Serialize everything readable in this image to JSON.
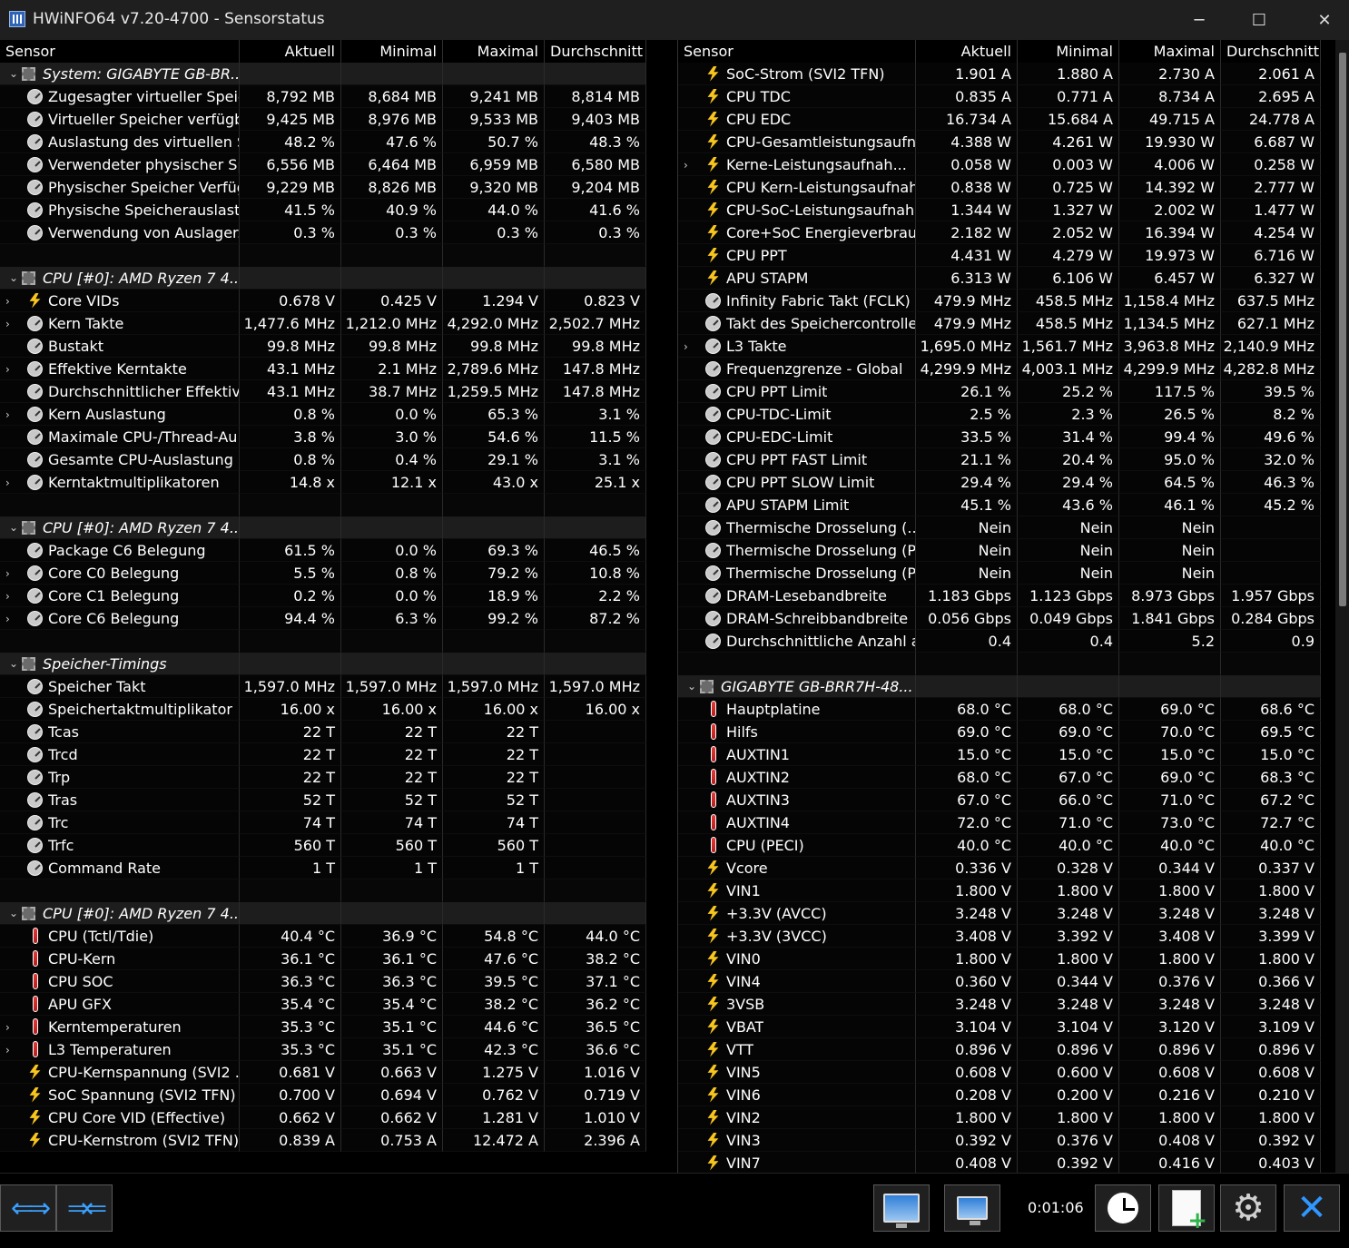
{
  "window": {
    "title": "HWiNFO64 v7.20-4700 - Sensorstatus",
    "minimize": "─",
    "maximize": "☐",
    "close": "✕"
  },
  "columns": [
    "Sensor",
    "Aktuell",
    "Minimal",
    "Maximal",
    "Durchschnitt"
  ],
  "left_rows": [
    {
      "t": "group",
      "name": "System: GIGABYTE GB-BR...",
      "icon": "chip-icon"
    },
    {
      "t": "row",
      "name": "Zugesagter virtueller Speic...",
      "icon": "gauge-icon",
      "v": [
        "8,792 MB",
        "8,684 MB",
        "9,241 MB",
        "8,814 MB"
      ]
    },
    {
      "t": "row",
      "name": "Virtueller Speicher verfügbar",
      "icon": "gauge-icon",
      "v": [
        "9,425 MB",
        "8,976 MB",
        "9,533 MB",
        "9,403 MB"
      ]
    },
    {
      "t": "row",
      "name": "Auslastung des virtuellen S...",
      "icon": "gauge-icon",
      "v": [
        "48.2 %",
        "47.6 %",
        "50.7 %",
        "48.3 %"
      ]
    },
    {
      "t": "row",
      "name": "Verwendeter physischer Sp...",
      "icon": "gauge-icon",
      "v": [
        "6,556 MB",
        "6,464 MB",
        "6,959 MB",
        "6,580 MB"
      ]
    },
    {
      "t": "row",
      "name": "Physischer Speicher Verfüg...",
      "icon": "gauge-icon",
      "v": [
        "9,229 MB",
        "8,826 MB",
        "9,320 MB",
        "9,204 MB"
      ]
    },
    {
      "t": "row",
      "name": "Physische Speicherauslastu...",
      "icon": "gauge-icon",
      "v": [
        "41.5 %",
        "40.9 %",
        "44.0 %",
        "41.6 %"
      ]
    },
    {
      "t": "row",
      "name": "Verwendung von Auslager...",
      "icon": "gauge-icon",
      "v": [
        "0.3 %",
        "0.3 %",
        "0.3 %",
        "0.3 %"
      ]
    },
    {
      "t": "blank"
    },
    {
      "t": "group",
      "name": "CPU [#0]: AMD Ryzen 7 4...",
      "icon": "chip-icon"
    },
    {
      "t": "row",
      "sub": true,
      "name": "Core VIDs",
      "icon": "bolt-icon",
      "v": [
        "0.678 V",
        "0.425 V",
        "1.294 V",
        "0.823 V"
      ]
    },
    {
      "t": "row",
      "sub": true,
      "name": "Kern Takte",
      "icon": "gauge-icon",
      "v": [
        "1,477.6 MHz",
        "1,212.0 MHz",
        "4,292.0 MHz",
        "2,502.7 MHz"
      ]
    },
    {
      "t": "row",
      "name": "Bustakt",
      "icon": "gauge-icon",
      "v": [
        "99.8 MHz",
        "99.8 MHz",
        "99.8 MHz",
        "99.8 MHz"
      ]
    },
    {
      "t": "row",
      "sub": true,
      "name": "Effektive Kerntakte",
      "icon": "gauge-icon",
      "v": [
        "43.1 MHz",
        "2.1 MHz",
        "2,789.6 MHz",
        "147.8 MHz"
      ]
    },
    {
      "t": "row",
      "name": "Durchschnittlicher Effektive...",
      "icon": "gauge-icon",
      "v": [
        "43.1 MHz",
        "38.7 MHz",
        "1,259.5 MHz",
        "147.8 MHz"
      ]
    },
    {
      "t": "row",
      "sub": true,
      "name": "Kern Auslastung",
      "icon": "gauge-icon",
      "v": [
        "0.8 %",
        "0.0 %",
        "65.3 %",
        "3.1 %"
      ]
    },
    {
      "t": "row",
      "name": "Maximale CPU-/Thread-Au...",
      "icon": "gauge-icon",
      "v": [
        "3.8 %",
        "3.0 %",
        "54.6 %",
        "11.5 %"
      ]
    },
    {
      "t": "row",
      "name": "Gesamte CPU-Auslastung",
      "icon": "gauge-icon",
      "v": [
        "0.8 %",
        "0.4 %",
        "29.1 %",
        "3.1 %"
      ]
    },
    {
      "t": "row",
      "sub": true,
      "name": "Kerntaktmultiplikatoren",
      "icon": "gauge-icon",
      "v": [
        "14.8 x",
        "12.1 x",
        "43.0 x",
        "25.1 x"
      ]
    },
    {
      "t": "blank"
    },
    {
      "t": "group",
      "name": "CPU [#0]: AMD Ryzen 7 4...",
      "icon": "chip-icon"
    },
    {
      "t": "row",
      "name": "Package C6 Belegung",
      "icon": "gauge-icon",
      "v": [
        "61.5 %",
        "0.0 %",
        "69.3 %",
        "46.5 %"
      ]
    },
    {
      "t": "row",
      "sub": true,
      "name": "Core C0 Belegung",
      "icon": "gauge-icon",
      "v": [
        "5.5 %",
        "0.8 %",
        "79.2 %",
        "10.8 %"
      ]
    },
    {
      "t": "row",
      "sub": true,
      "name": "Core C1 Belegung",
      "icon": "gauge-icon",
      "v": [
        "0.2 %",
        "0.0 %",
        "18.9 %",
        "2.2 %"
      ]
    },
    {
      "t": "row",
      "sub": true,
      "name": "Core C6 Belegung",
      "icon": "gauge-icon",
      "v": [
        "94.4 %",
        "6.3 %",
        "99.2 %",
        "87.2 %"
      ]
    },
    {
      "t": "blank"
    },
    {
      "t": "group",
      "name": "Speicher-Timings",
      "icon": "chip-icon"
    },
    {
      "t": "row",
      "name": "Speicher Takt",
      "icon": "gauge-icon",
      "v": [
        "1,597.0 MHz",
        "1,597.0 MHz",
        "1,597.0 MHz",
        "1,597.0 MHz"
      ]
    },
    {
      "t": "row",
      "name": "Speichertaktmultiplikator",
      "icon": "gauge-icon",
      "v": [
        "16.00 x",
        "16.00 x",
        "16.00 x",
        "16.00 x"
      ]
    },
    {
      "t": "row",
      "name": "Tcas",
      "icon": "gauge-icon",
      "v": [
        "22 T",
        "22 T",
        "22 T",
        ""
      ]
    },
    {
      "t": "row",
      "name": "Trcd",
      "icon": "gauge-icon",
      "v": [
        "22 T",
        "22 T",
        "22 T",
        ""
      ]
    },
    {
      "t": "row",
      "name": "Trp",
      "icon": "gauge-icon",
      "v": [
        "22 T",
        "22 T",
        "22 T",
        ""
      ]
    },
    {
      "t": "row",
      "name": "Tras",
      "icon": "gauge-icon",
      "v": [
        "52 T",
        "52 T",
        "52 T",
        ""
      ]
    },
    {
      "t": "row",
      "name": "Trc",
      "icon": "gauge-icon",
      "v": [
        "74 T",
        "74 T",
        "74 T",
        ""
      ]
    },
    {
      "t": "row",
      "name": "Trfc",
      "icon": "gauge-icon",
      "v": [
        "560 T",
        "560 T",
        "560 T",
        ""
      ]
    },
    {
      "t": "row",
      "name": "Command Rate",
      "icon": "gauge-icon",
      "v": [
        "1 T",
        "1 T",
        "1 T",
        ""
      ]
    },
    {
      "t": "blank"
    },
    {
      "t": "group",
      "name": "CPU [#0]: AMD Ryzen 7 4...",
      "icon": "chip-icon"
    },
    {
      "t": "row",
      "name": "CPU (Tctl/Tdie)",
      "icon": "thermometer-icon",
      "v": [
        "40.4 °C",
        "36.9 °C",
        "54.8 °C",
        "44.0 °C"
      ]
    },
    {
      "t": "row",
      "name": "CPU-Kern",
      "icon": "thermometer-icon",
      "v": [
        "36.1 °C",
        "36.1 °C",
        "47.6 °C",
        "38.2 °C"
      ]
    },
    {
      "t": "row",
      "name": "CPU SOC",
      "icon": "thermometer-icon",
      "v": [
        "36.3 °C",
        "36.3 °C",
        "39.5 °C",
        "37.1 °C"
      ]
    },
    {
      "t": "row",
      "name": "APU GFX",
      "icon": "thermometer-icon",
      "v": [
        "35.4 °C",
        "35.4 °C",
        "38.2 °C",
        "36.2 °C"
      ]
    },
    {
      "t": "row",
      "sub": true,
      "name": "Kerntemperaturen",
      "icon": "thermometer-icon",
      "v": [
        "35.3 °C",
        "35.1 °C",
        "44.6 °C",
        "36.5 °C"
      ]
    },
    {
      "t": "row",
      "sub": true,
      "name": "L3 Temperaturen",
      "icon": "thermometer-icon",
      "v": [
        "35.3 °C",
        "35.1 °C",
        "42.3 °C",
        "36.6 °C"
      ]
    },
    {
      "t": "row",
      "name": "CPU-Kernspannung (SVI2 ...",
      "icon": "bolt-icon",
      "v": [
        "0.681 V",
        "0.663 V",
        "1.275 V",
        "1.016 V"
      ]
    },
    {
      "t": "row",
      "name": "SoC Spannung (SVI2 TFN)",
      "icon": "bolt-icon",
      "v": [
        "0.700 V",
        "0.694 V",
        "0.762 V",
        "0.719 V"
      ]
    },
    {
      "t": "row",
      "name": "CPU Core VID (Effective)",
      "icon": "bolt-icon",
      "v": [
        "0.662 V",
        "0.662 V",
        "1.281 V",
        "1.010 V"
      ]
    },
    {
      "t": "row",
      "name": "CPU-Kernstrom (SVI2 TFN)",
      "icon": "bolt-icon",
      "v": [
        "0.839 A",
        "0.753 A",
        "12.472 A",
        "2.396 A"
      ]
    }
  ],
  "right_rows": [
    {
      "t": "row",
      "name": "SoC-Strom (SVI2 TFN)",
      "icon": "bolt-icon",
      "v": [
        "1.901 A",
        "1.880 A",
        "2.730 A",
        "2.061 A"
      ]
    },
    {
      "t": "row",
      "name": "CPU TDC",
      "icon": "bolt-icon",
      "v": [
        "0.835 A",
        "0.771 A",
        "8.734 A",
        "2.695 A"
      ]
    },
    {
      "t": "row",
      "name": "CPU EDC",
      "icon": "bolt-icon",
      "v": [
        "16.734 A",
        "15.684 A",
        "49.715 A",
        "24.778 A"
      ]
    },
    {
      "t": "row",
      "name": "CPU-Gesamtleistungsaufn...",
      "icon": "bolt-icon",
      "v": [
        "4.388 W",
        "4.261 W",
        "19.930 W",
        "6.687 W"
      ]
    },
    {
      "t": "row",
      "sub": true,
      "name": "Kerne-Leistungsaufnah...",
      "icon": "bolt-icon",
      "v": [
        "0.058 W",
        "0.003 W",
        "4.006 W",
        "0.258 W"
      ]
    },
    {
      "t": "row",
      "name": "CPU Kern-Leistungsaufnah...",
      "icon": "bolt-icon",
      "v": [
        "0.838 W",
        "0.725 W",
        "14.392 W",
        "2.777 W"
      ]
    },
    {
      "t": "row",
      "name": "CPU-SoC-Leistungsaufnah...",
      "icon": "bolt-icon",
      "v": [
        "1.344 W",
        "1.327 W",
        "2.002 W",
        "1.477 W"
      ]
    },
    {
      "t": "row",
      "name": "Core+SoC Energieverbrau...",
      "icon": "bolt-icon",
      "v": [
        "2.182 W",
        "2.052 W",
        "16.394 W",
        "4.254 W"
      ]
    },
    {
      "t": "row",
      "name": "CPU PPT",
      "icon": "bolt-icon",
      "v": [
        "4.431 W",
        "4.279 W",
        "19.973 W",
        "6.716 W"
      ]
    },
    {
      "t": "row",
      "name": "APU STAPM",
      "icon": "bolt-icon",
      "v": [
        "6.313 W",
        "6.106 W",
        "6.457 W",
        "6.327 W"
      ]
    },
    {
      "t": "row",
      "name": "Infinity Fabric Takt (FCLK)",
      "icon": "gauge-icon",
      "v": [
        "479.9 MHz",
        "458.5 MHz",
        "1,158.4 MHz",
        "637.5 MHz"
      ]
    },
    {
      "t": "row",
      "name": "Takt des Speichercontrolle...",
      "icon": "gauge-icon",
      "v": [
        "479.9 MHz",
        "458.5 MHz",
        "1,134.5 MHz",
        "627.1 MHz"
      ]
    },
    {
      "t": "row",
      "sub": true,
      "name": "L3 Takte",
      "icon": "gauge-icon",
      "v": [
        "1,695.0 MHz",
        "1,561.7 MHz",
        "3,963.8 MHz",
        "2,140.9 MHz"
      ]
    },
    {
      "t": "row",
      "name": "Frequenzgrenze - Global",
      "icon": "gauge-icon",
      "v": [
        "4,299.9 MHz",
        "4,003.1 MHz",
        "4,299.9 MHz",
        "4,282.8 MHz"
      ]
    },
    {
      "t": "row",
      "name": "CPU PPT Limit",
      "icon": "gauge-icon",
      "v": [
        "26.1 %",
        "25.2 %",
        "117.5 %",
        "39.5 %"
      ]
    },
    {
      "t": "row",
      "name": "CPU-TDC-Limit",
      "icon": "gauge-icon",
      "v": [
        "2.5 %",
        "2.3 %",
        "26.5 %",
        "8.2 %"
      ]
    },
    {
      "t": "row",
      "name": "CPU-EDC-Limit",
      "icon": "gauge-icon",
      "v": [
        "33.5 %",
        "31.4 %",
        "99.4 %",
        "49.6 %"
      ]
    },
    {
      "t": "row",
      "name": "CPU PPT FAST Limit",
      "icon": "gauge-icon",
      "v": [
        "21.1 %",
        "20.4 %",
        "95.0 %",
        "32.0 %"
      ]
    },
    {
      "t": "row",
      "name": "CPU PPT SLOW Limit",
      "icon": "gauge-icon",
      "v": [
        "29.4 %",
        "29.4 %",
        "64.5 %",
        "46.3 %"
      ]
    },
    {
      "t": "row",
      "name": "APU STAPM Limit",
      "icon": "gauge-icon",
      "v": [
        "45.1 %",
        "43.6 %",
        "46.1 %",
        "45.2 %"
      ]
    },
    {
      "t": "row",
      "name": "Thermische Drosselung (...",
      "icon": "gauge-icon",
      "v": [
        "Nein",
        "Nein",
        "Nein",
        ""
      ]
    },
    {
      "t": "row",
      "name": "Thermische Drosselung (P...",
      "icon": "gauge-icon",
      "v": [
        "Nein",
        "Nein",
        "Nein",
        ""
      ]
    },
    {
      "t": "row",
      "name": "Thermische Drosselung (P...",
      "icon": "gauge-icon",
      "v": [
        "Nein",
        "Nein",
        "Nein",
        ""
      ]
    },
    {
      "t": "row",
      "name": "DRAM-Lesebandbreite",
      "icon": "gauge-icon",
      "v": [
        "1.183 Gbps",
        "1.123 Gbps",
        "8.973 Gbps",
        "1.957 Gbps"
      ]
    },
    {
      "t": "row",
      "name": "DRAM-Schreibbandbreite",
      "icon": "gauge-icon",
      "v": [
        "0.056 Gbps",
        "0.049 Gbps",
        "1.841 Gbps",
        "0.284 Gbps"
      ]
    },
    {
      "t": "row",
      "name": "Durchschnittliche Anzahl a...",
      "icon": "gauge-icon",
      "v": [
        "0.4",
        "0.4",
        "5.2",
        "0.9"
      ]
    },
    {
      "t": "blank"
    },
    {
      "t": "group",
      "name": "GIGABYTE GB-BRR7H-48...",
      "icon": "chip-icon"
    },
    {
      "t": "row",
      "name": "Hauptplatine",
      "icon": "thermometer-icon",
      "v": [
        "68.0 °C",
        "68.0 °C",
        "69.0 °C",
        "68.6 °C"
      ]
    },
    {
      "t": "row",
      "name": "Hilfs",
      "icon": "thermometer-icon",
      "v": [
        "69.0 °C",
        "69.0 °C",
        "70.0 °C",
        "69.5 °C"
      ]
    },
    {
      "t": "row",
      "name": "AUXTIN1",
      "icon": "thermometer-icon",
      "v": [
        "15.0 °C",
        "15.0 °C",
        "15.0 °C",
        "15.0 °C"
      ]
    },
    {
      "t": "row",
      "name": "AUXTIN2",
      "icon": "thermometer-icon",
      "v": [
        "68.0 °C",
        "67.0 °C",
        "69.0 °C",
        "68.3 °C"
      ]
    },
    {
      "t": "row",
      "name": "AUXTIN3",
      "icon": "thermometer-icon",
      "v": [
        "67.0 °C",
        "66.0 °C",
        "71.0 °C",
        "67.2 °C"
      ]
    },
    {
      "t": "row",
      "name": "AUXTIN4",
      "icon": "thermometer-icon",
      "v": [
        "72.0 °C",
        "71.0 °C",
        "73.0 °C",
        "72.7 °C"
      ]
    },
    {
      "t": "row",
      "name": "CPU (PECI)",
      "icon": "thermometer-icon",
      "v": [
        "40.0 °C",
        "40.0 °C",
        "40.0 °C",
        "40.0 °C"
      ]
    },
    {
      "t": "row",
      "name": "Vcore",
      "icon": "bolt-icon",
      "v": [
        "0.336 V",
        "0.328 V",
        "0.344 V",
        "0.337 V"
      ]
    },
    {
      "t": "row",
      "name": "VIN1",
      "icon": "bolt-icon",
      "v": [
        "1.800 V",
        "1.800 V",
        "1.800 V",
        "1.800 V"
      ]
    },
    {
      "t": "row",
      "name": "+3.3V (AVCC)",
      "icon": "bolt-icon",
      "v": [
        "3.248 V",
        "3.248 V",
        "3.248 V",
        "3.248 V"
      ]
    },
    {
      "t": "row",
      "name": "+3.3V (3VCC)",
      "icon": "bolt-icon",
      "v": [
        "3.408 V",
        "3.392 V",
        "3.408 V",
        "3.399 V"
      ]
    },
    {
      "t": "row",
      "name": "VIN0",
      "icon": "bolt-icon",
      "v": [
        "1.800 V",
        "1.800 V",
        "1.800 V",
        "1.800 V"
      ]
    },
    {
      "t": "row",
      "name": "VIN4",
      "icon": "bolt-icon",
      "v": [
        "0.360 V",
        "0.344 V",
        "0.376 V",
        "0.366 V"
      ]
    },
    {
      "t": "row",
      "name": "3VSB",
      "icon": "bolt-icon",
      "v": [
        "3.248 V",
        "3.248 V",
        "3.248 V",
        "3.248 V"
      ]
    },
    {
      "t": "row",
      "name": "VBAT",
      "icon": "bolt-icon",
      "v": [
        "3.104 V",
        "3.104 V",
        "3.120 V",
        "3.109 V"
      ]
    },
    {
      "t": "row",
      "name": "VTT",
      "icon": "bolt-icon",
      "v": [
        "0.896 V",
        "0.896 V",
        "0.896 V",
        "0.896 V"
      ]
    },
    {
      "t": "row",
      "name": "VIN5",
      "icon": "bolt-icon",
      "v": [
        "0.608 V",
        "0.600 V",
        "0.608 V",
        "0.608 V"
      ]
    },
    {
      "t": "row",
      "name": "VIN6",
      "icon": "bolt-icon",
      "v": [
        "0.208 V",
        "0.200 V",
        "0.216 V",
        "0.210 V"
      ]
    },
    {
      "t": "row",
      "name": "VIN2",
      "icon": "bolt-icon",
      "v": [
        "1.800 V",
        "1.800 V",
        "1.800 V",
        "1.800 V"
      ]
    },
    {
      "t": "row",
      "name": "VIN3",
      "icon": "bolt-icon",
      "v": [
        "0.392 V",
        "0.376 V",
        "0.408 V",
        "0.392 V"
      ]
    },
    {
      "t": "row",
      "name": "VIN7",
      "icon": "bolt-icon",
      "v": [
        "0.408 V",
        "0.392 V",
        "0.416 V",
        "0.403 V"
      ]
    }
  ],
  "statusbar": {
    "timer": "0:01:06"
  }
}
